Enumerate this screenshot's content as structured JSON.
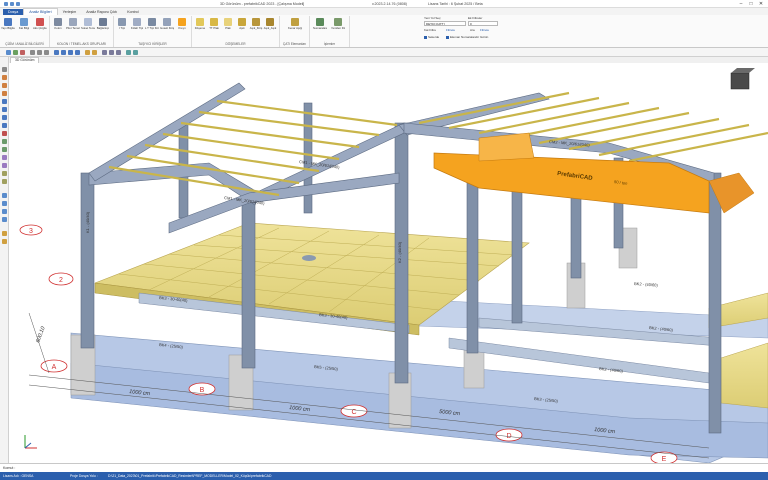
{
  "window": {
    "title": "3D Görünüm - prefabrikCAD 2023 - [Çalışma Modeli]",
    "version": "v.2023.2.14.76 (0808)",
    "license": "Lisans Tarihi : 6 Şubat 2025 / Beta",
    "controls": [
      "–",
      "□",
      "✕"
    ]
  },
  "tabs": [
    "Dosya",
    "Analiz Bilgileri",
    "Yerleşim",
    "Analiz Raporu Çıktı",
    "Kontrol"
  ],
  "ribbon": {
    "groups": [
      {
        "label": "ÇİZİM / ANALİZ BİLGİLERİ",
        "buttons": [
          "Yapı Bilgileri",
          "Kat Bilgi",
          "Aks Çizgileri"
        ]
      },
      {
        "label": "KOLON / TEMEL-AKS GRUPLARI",
        "buttons": [
          "Kolon",
          "Pilot Temel",
          "Soket Temel",
          "Bağlantıçı"
        ]
      },
      {
        "label": "TAŞIYICI KİRİŞLER",
        "buttons": [
          "I Tipi",
          "Külah Tipi",
          "L T Tipi Kiriş",
          "Guseli Kiriş",
          "Kreyn"
        ]
      },
      {
        "label": "DÖŞEMELER",
        "buttons": [
          "Döşeme",
          "TT Plak",
          "Plak",
          "Aşık",
          "Aşık_Kiriş",
          "Aşık_Aşık"
        ]
      },
      {
        "label": "ÇATI Elemanları",
        "buttons": [
          "Kenar Aşığı"
        ]
      },
      {
        "label": "İşlemler",
        "buttons": [
          "Numaralandır",
          "Yeniden Düzenle"
        ]
      }
    ],
    "right_panel": {
      "search_label": "Yeni Yol Seç",
      "filter_label": "Ek Filtreler",
      "selected_value": "DETAY-KATTI",
      "second_value": "0",
      "btn_kat": "Kat Filtre",
      "btn_filtre": "Filtrele",
      "btn_ara": "Ara",
      "btn_filtre2": "Filtrele",
      "chk_sekerde": "Sekerde",
      "chk_numara": "Eleman Numaralandır Görün"
    }
  },
  "viewport_tab": "3D Görünüm",
  "labels3d": {
    "beam_top1": "CM1 - MK_20/61/(040)",
    "beam_top2": "CM1 - MK_20/61/(040)",
    "beam_top3": "CM2 - MK_20/61/(040)",
    "crane": "PrefabriCAD",
    "crane_sub": "50 / ton",
    "girder1": "BK3 - 30-40(40)",
    "girder2": "BK3 - 30-40(40)",
    "ground1": "BK4 - (25/50)",
    "ground2": "BK5 - (25/50)",
    "ground3": "BK3 - (25/50)",
    "ground4": "BK2 - (40/60)",
    "ground5": "BK2 - (40/60)",
    "ground6": "BK2 - (40/60)",
    "dim1": "1000 cm",
    "dim2": "1000 cm",
    "dim3": "5000 cm",
    "dim4": "1000 cm",
    "dim_vert": "600,10",
    "axes": [
      "A",
      "B",
      "C",
      "D",
      "E",
      "1",
      "2",
      "3"
    ],
    "col1": "K1 - (40/40)",
    "col2": "K2 - (40/40)"
  },
  "command": "Komut :",
  "status": {
    "user": "Lisans Adı : GENSA",
    "project_label": "Proje Dosya Yolu :",
    "project_path": "D:\\21_Data_2023\\01_Prefabrik\\PrefabrikCAD_Resimleri\\PREF_MODELLER\\Model_02_Küçük\\prefabrikCAD"
  },
  "colors": {
    "steel": "#8090a8",
    "steel_dark": "#5d6b82",
    "slab": "#e8dc8a",
    "purlin": "#c9b54a",
    "foundation": "#b7c8e6",
    "crane": "#f5a31f",
    "axis_red": "#d03030",
    "ribbon_blue": "#2b5fad"
  }
}
